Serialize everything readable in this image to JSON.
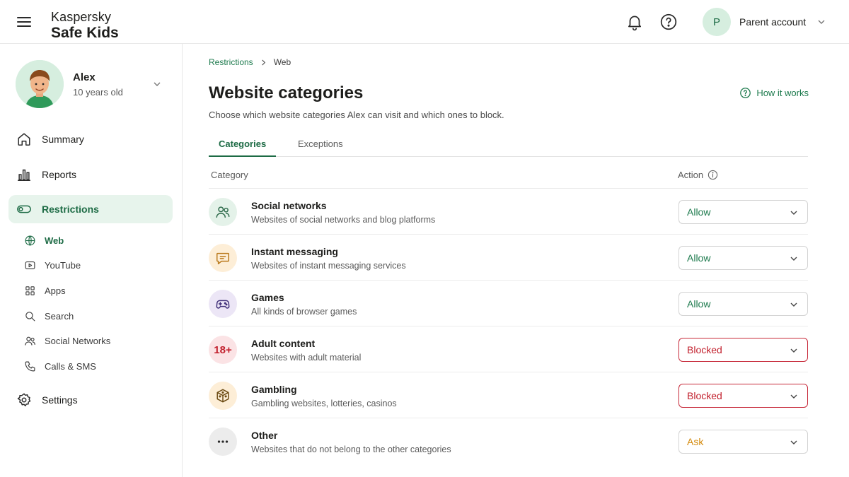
{
  "app": {
    "brand_line1": "Kaspersky",
    "brand_line2": "Safe Kids",
    "account_initial": "P",
    "account_name": "Parent account"
  },
  "child": {
    "name": "Alex",
    "age": "10 years old"
  },
  "nav": {
    "summary": "Summary",
    "reports": "Reports",
    "restrictions": "Restrictions",
    "settings": "Settings",
    "sub": {
      "web": "Web",
      "youtube": "YouTube",
      "apps": "Apps",
      "search": "Search",
      "social_networks": "Social Networks",
      "calls_sms": "Calls & SMS"
    }
  },
  "page": {
    "breadcrumb_parent": "Restrictions",
    "breadcrumb_current": "Web",
    "title": "Website categories",
    "how_it_works": "How it works",
    "subtitle": "Choose which website categories Alex can visit and which ones to block.",
    "tabs": [
      "Categories",
      "Exceptions"
    ],
    "col_category": "Category",
    "col_action": "Action"
  },
  "categories": [
    {
      "name": "Social networks",
      "desc": "Websites of social networks and blog platforms",
      "action": "Allow",
      "icon": "people-icon"
    },
    {
      "name": "Instant messaging",
      "desc": "Websites of instant messaging services",
      "action": "Allow",
      "icon": "chat-icon"
    },
    {
      "name": "Games",
      "desc": "All kinds of browser games",
      "action": "Allow",
      "icon": "gamepad-icon"
    },
    {
      "name": "Adult content",
      "desc": "Websites with adult material",
      "action": "Blocked",
      "icon": "18-plus-icon",
      "icon_text": "18+"
    },
    {
      "name": "Gambling",
      "desc": "Gambling websites, lotteries, casinos",
      "action": "Blocked",
      "icon": "dice-icon"
    },
    {
      "name": "Other",
      "desc": "Websites that do not belong to the other categories",
      "action": "Ask",
      "icon": "more-icon"
    }
  ],
  "colors": {
    "accent_green": "#1d6b45",
    "blocked_red": "#c2202d",
    "ask_orange": "#d48a0c",
    "active_bg": "#e7f4ec"
  }
}
